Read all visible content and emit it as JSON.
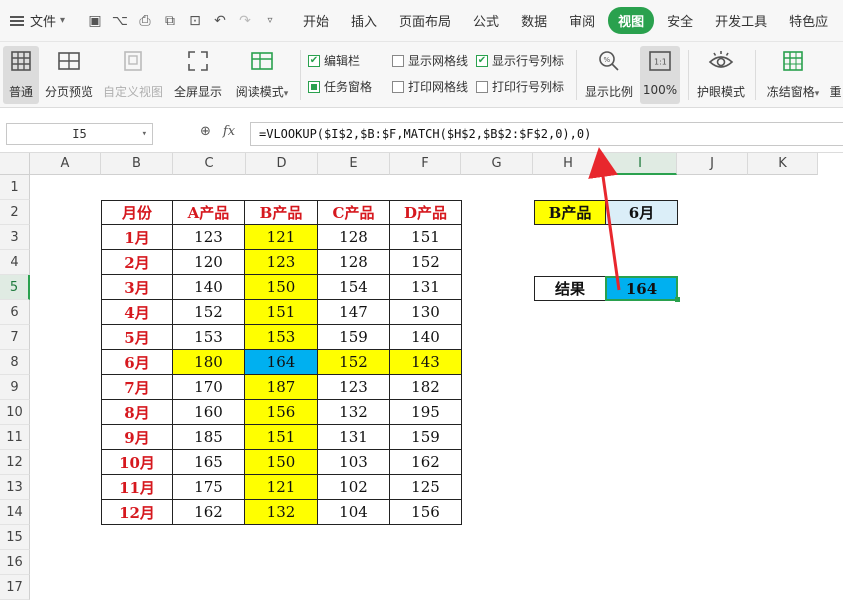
{
  "menubar": {
    "file_label": "文件",
    "tabs": [
      "开始",
      "插入",
      "页面布局",
      "公式",
      "数据",
      "审阅",
      "视图",
      "安全",
      "开发工具",
      "特色应"
    ],
    "active_tab": "视图"
  },
  "ribbon": {
    "normal": "普通",
    "page_break": "分页预览",
    "custom_view": "自定义视图",
    "fullscreen": "全屏显示",
    "reading_mode": "阅读模式",
    "edit_bar": "编辑栏",
    "task_pane": "任务窗格",
    "show_gridlines": "显示网格线",
    "print_gridlines": "打印网格线",
    "show_headers": "显示行号列标",
    "print_headers": "打印行号列标",
    "zoom": "显示比例",
    "zoom_100": "100%",
    "eye_mode": "护眼模式",
    "freeze": "冻结窗格",
    "more": "重"
  },
  "formula_bar": {
    "name_box": "I5",
    "formula": "=VLOOKUP($I$2,$B:$F,MATCH($H$2,$B$2:$F$2,0),0)"
  },
  "columns": [
    "A",
    "B",
    "C",
    "D",
    "E",
    "F",
    "G",
    "H",
    "I",
    "J",
    "K"
  ],
  "rows": [
    "1",
    "2",
    "3",
    "4",
    "5",
    "6",
    "7",
    "8",
    "9",
    "10",
    "11",
    "12",
    "13",
    "14",
    "15",
    "16",
    "17"
  ],
  "table": {
    "headers": [
      "月份",
      "A产品",
      "B产品",
      "C产品",
      "D产品"
    ],
    "rows": [
      [
        "1月",
        "123",
        "121",
        "128",
        "151"
      ],
      [
        "2月",
        "120",
        "123",
        "128",
        "152"
      ],
      [
        "3月",
        "140",
        "150",
        "154",
        "131"
      ],
      [
        "4月",
        "152",
        "151",
        "147",
        "130"
      ],
      [
        "5月",
        "153",
        "153",
        "159",
        "140"
      ],
      [
        "6月",
        "180",
        "164",
        "152",
        "143"
      ],
      [
        "7月",
        "170",
        "187",
        "123",
        "182"
      ],
      [
        "8月",
        "160",
        "156",
        "132",
        "195"
      ],
      [
        "9月",
        "185",
        "151",
        "131",
        "159"
      ],
      [
        "10月",
        "165",
        "150",
        "103",
        "162"
      ],
      [
        "11月",
        "175",
        "121",
        "102",
        "125"
      ],
      [
        "12月",
        "162",
        "132",
        "104",
        "156"
      ]
    ]
  },
  "lookup": {
    "product_label": "B产品",
    "month_value": "6月",
    "result_label": "结果",
    "result_value": "164"
  },
  "colors": {
    "highlight_yellow": "#ffff00",
    "highlight_blue": "#00b0f0",
    "header_red": "#d6181e",
    "accent_green": "#2aa14e",
    "arrow_red": "#e8272d"
  }
}
